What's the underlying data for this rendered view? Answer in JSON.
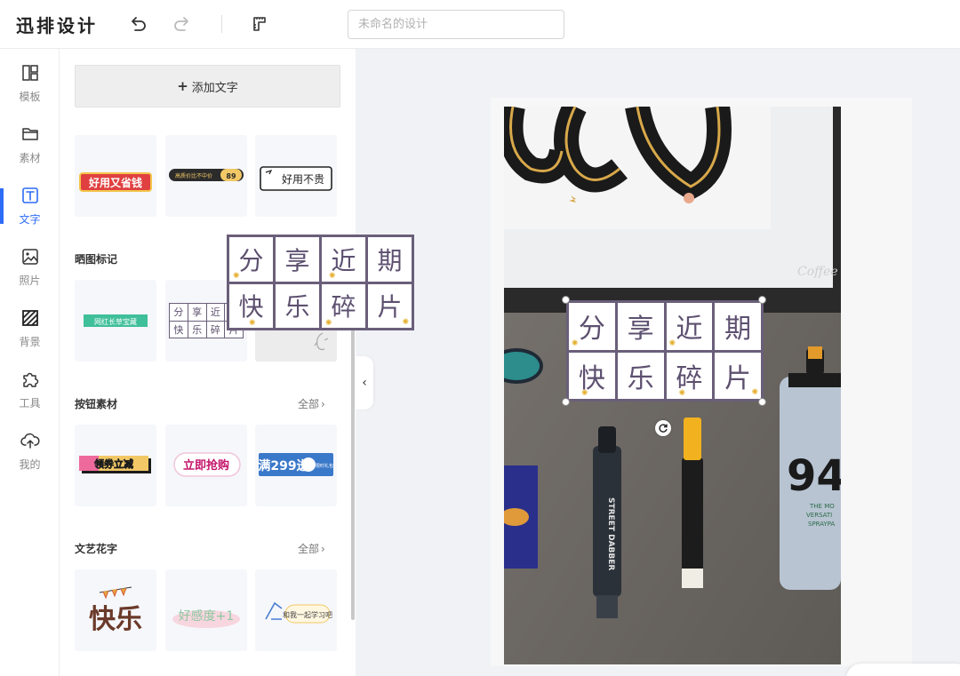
{
  "app": {
    "logo": "迅排设计"
  },
  "toolbar": {
    "title_placeholder": "未命名的设计",
    "title_value": ""
  },
  "rail": {
    "items": [
      {
        "label": "模板",
        "icon": "template-icon"
      },
      {
        "label": "素材",
        "icon": "folder-icon"
      },
      {
        "label": "文字",
        "icon": "text-icon",
        "active": true
      },
      {
        "label": "照片",
        "icon": "image-icon"
      },
      {
        "label": "背景",
        "icon": "background-icon"
      },
      {
        "label": "工具",
        "icon": "puzzle-icon"
      },
      {
        "label": "我的",
        "icon": "cloud-upload-icon"
      }
    ]
  },
  "panel": {
    "add_text_label": "添加文字",
    "sections": [
      {
        "title": "晒图标记",
        "items": [
          {
            "label": "网红长草宝藏"
          },
          {
            "label": "分享近期快乐碎片"
          },
          {
            "label": ""
          }
        ]
      },
      {
        "title": "按钮素材",
        "all_label": "全部",
        "items": [
          {
            "label": "领券立减"
          },
          {
            "label": "立即抢购"
          },
          {
            "label": "满299送",
            "suffix": "限时礼包"
          }
        ]
      },
      {
        "title": "文艺花字",
        "all_label": "全部",
        "items": [
          {
            "label": "快乐"
          },
          {
            "label": "好感度+1"
          },
          {
            "label": "和我一起学习吧"
          }
        ]
      }
    ],
    "top_row_items": [
      {
        "label": "好用又省钱"
      },
      {
        "label": "高质价比不中价"
      },
      {
        "label": "好用不贵"
      }
    ]
  },
  "element": {
    "characters": [
      "分",
      "享",
      "近",
      "期",
      "快",
      "乐",
      "碎",
      "片"
    ]
  },
  "colors": {
    "accent": "#2d6cf6",
    "grid_border": "#6a5f7a",
    "grid_text": "#5d5070"
  }
}
